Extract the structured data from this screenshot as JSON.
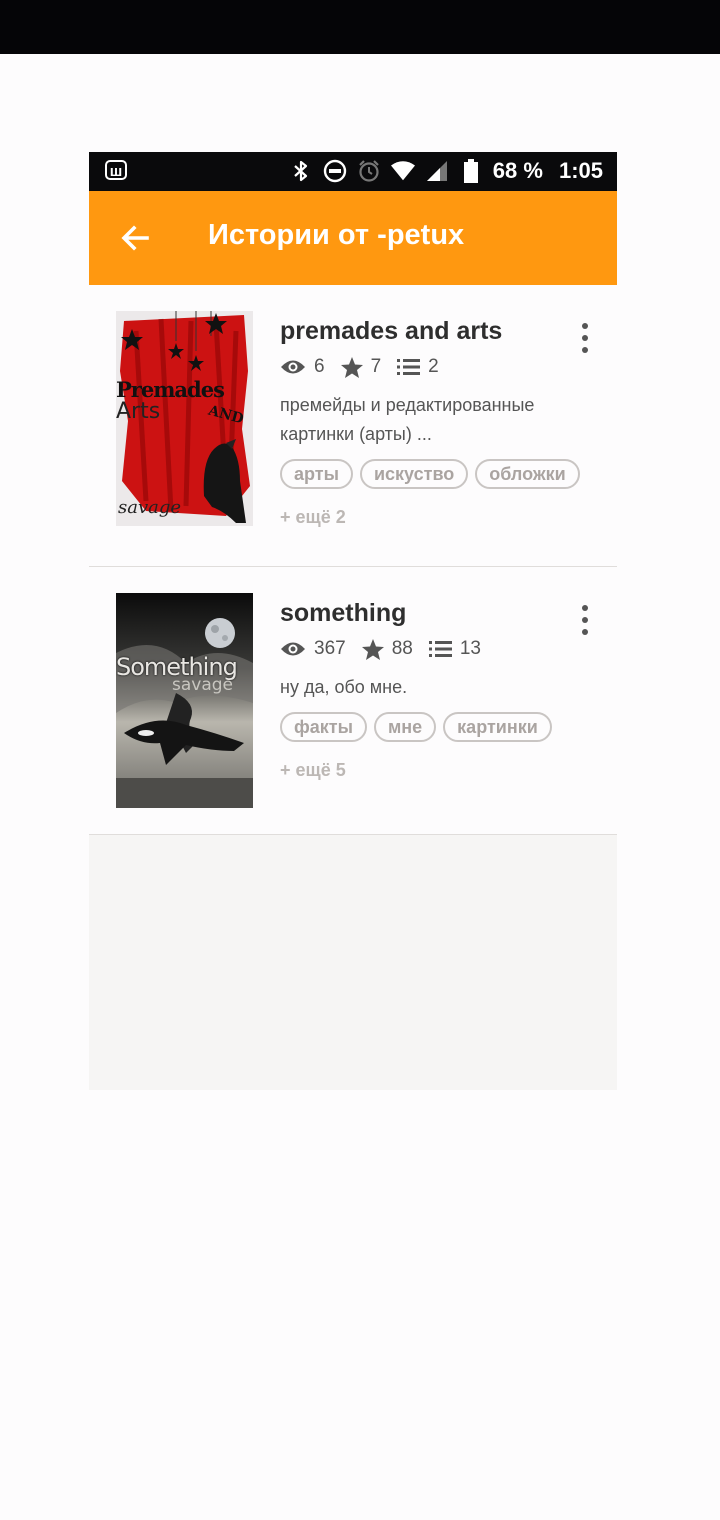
{
  "status_bar": {
    "notification_icon": "ш",
    "icons": [
      "bluetooth-icon",
      "do-not-disturb-icon",
      "alarm-icon",
      "wifi-icon",
      "signal-icon",
      "battery-icon"
    ],
    "battery": "68 %",
    "time": "1:05"
  },
  "app_bar": {
    "title": "Истории от -petux",
    "color": "#ff9810"
  },
  "stories": [
    {
      "title": "premades and arts",
      "views": "6",
      "votes": "7",
      "parts": "2",
      "description": "премейды и редактированные картинки (арты) ...",
      "tags": [
        "арты",
        "искуство",
        "обложки"
      ],
      "more_tags": "+ ещё 2",
      "cover_texts": [
        "Premades",
        "AND",
        "Arts",
        "savage"
      ]
    },
    {
      "title": "something",
      "views": "367",
      "votes": "88",
      "parts": "13",
      "description": "ну да, обо мне.",
      "tags": [
        "факты",
        "мне",
        "картинки"
      ],
      "more_tags": "+ ещё 5",
      "cover_texts": [
        "Something",
        "savage"
      ]
    }
  ]
}
